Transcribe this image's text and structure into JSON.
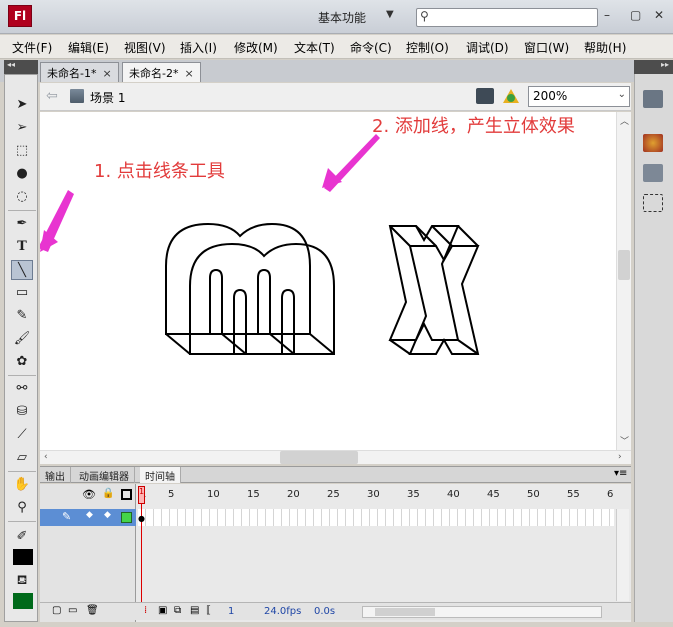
{
  "app": {
    "logo": "Fl",
    "workspace": "基本功能",
    "search_placeholder": ""
  },
  "window_buttons": {
    "minimize": "–",
    "restore": "▢",
    "close": "✕"
  },
  "menu": [
    "文件(F)",
    "编辑(E)",
    "视图(V)",
    "插入(I)",
    "修改(M)",
    "文本(T)",
    "命令(C)",
    "控制(O)",
    "调试(D)",
    "窗口(W)",
    "帮助(H)"
  ],
  "tabs": [
    {
      "label": "未命名-1*",
      "close": "×"
    },
    {
      "label": "未命名-2*",
      "close": "×"
    }
  ],
  "panel_collapse": "◂◂",
  "panel_collapse_right": "▸▸",
  "scene": {
    "label": "场景 1"
  },
  "zoom": {
    "value": "200%"
  },
  "annotations": {
    "step1": "1. 点击线条工具",
    "step2": "2. 添加线，产生立体效果"
  },
  "panel_tabs": [
    "输出",
    "动画编辑器",
    "时间轴"
  ],
  "timeline": {
    "frame_numbers": [
      "1",
      "5",
      "10",
      "15",
      "20",
      "25",
      "30",
      "35",
      "40",
      "45",
      "50",
      "55",
      "6"
    ],
    "footer": {
      "frame": "1",
      "fps": "24.0fps",
      "time": "0.0s"
    }
  },
  "colors": {
    "stroke": "#000000",
    "fill": "#006a1a",
    "layer_row": "#5c8ed4",
    "annotation": "#e23b3b"
  }
}
